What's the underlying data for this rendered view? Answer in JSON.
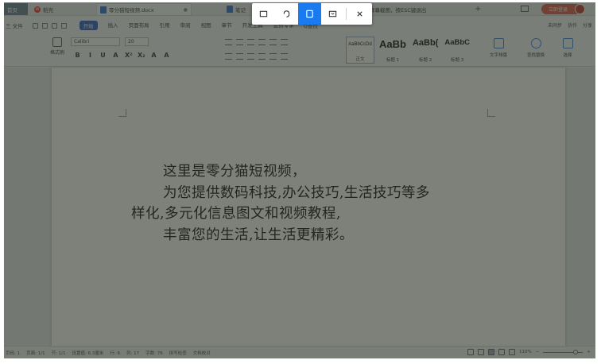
{
  "tabs": {
    "home": "首页",
    "wps": "稻壳",
    "doc": "零分猫短视频.docx",
    "note": "笔记",
    "capture": "屏幕截图，按ESC键退出"
  },
  "window": {
    "login": "立即登录"
  },
  "menu": {
    "file": "三 文件",
    "items": [
      "开始",
      "插入",
      "页面布局",
      "引用",
      "审阅",
      "视图",
      "章节",
      "开发工具",
      "会员专享"
    ],
    "active": "开始",
    "search": "Q查找",
    "right": [
      "未同步",
      "协作",
      "分享"
    ]
  },
  "ribbon": {
    "format_painter": "格式刷",
    "font_name": "Calibri",
    "font_size": "20",
    "format_buttons": [
      "B",
      "I",
      "U",
      "A",
      "X²",
      "X₂",
      "A",
      "A"
    ],
    "styles": [
      {
        "sample": "AaBbCcDd",
        "name": "正文"
      },
      {
        "sample": "AaBb",
        "name": "标题 1"
      },
      {
        "sample": "AaBb(",
        "name": "标题 2"
      },
      {
        "sample": "AaBbC",
        "name": "标题 3"
      }
    ],
    "text_tools": "文字排版",
    "find_replace": "查找替换",
    "select": "选择"
  },
  "document": {
    "lines": [
      "这里是零分猫短视频，",
      "为您提供数码科技,办公技巧,生活技巧等多",
      "样化,多元化信息图文和视频教程,",
      "丰富您的生活,让生活更精彩。"
    ]
  },
  "statusbar": {
    "page": "页码: 1",
    "pages": "页面: 1/1",
    "section": "节: 1/1",
    "position": "设置值: 6.3厘米",
    "row": "行: 6",
    "col": "列: 17",
    "words": "字数: 76",
    "spell": "拼写检查",
    "proofread": "文档校对",
    "zoom": "110%",
    "zoom_fraction": 0.85
  },
  "capture_toolbar": {
    "tools": [
      "rect-capture-icon",
      "free-capture-icon",
      "window-capture-icon",
      "fullscreen-capture-icon"
    ],
    "active_index": 2,
    "close": "close-icon"
  }
}
